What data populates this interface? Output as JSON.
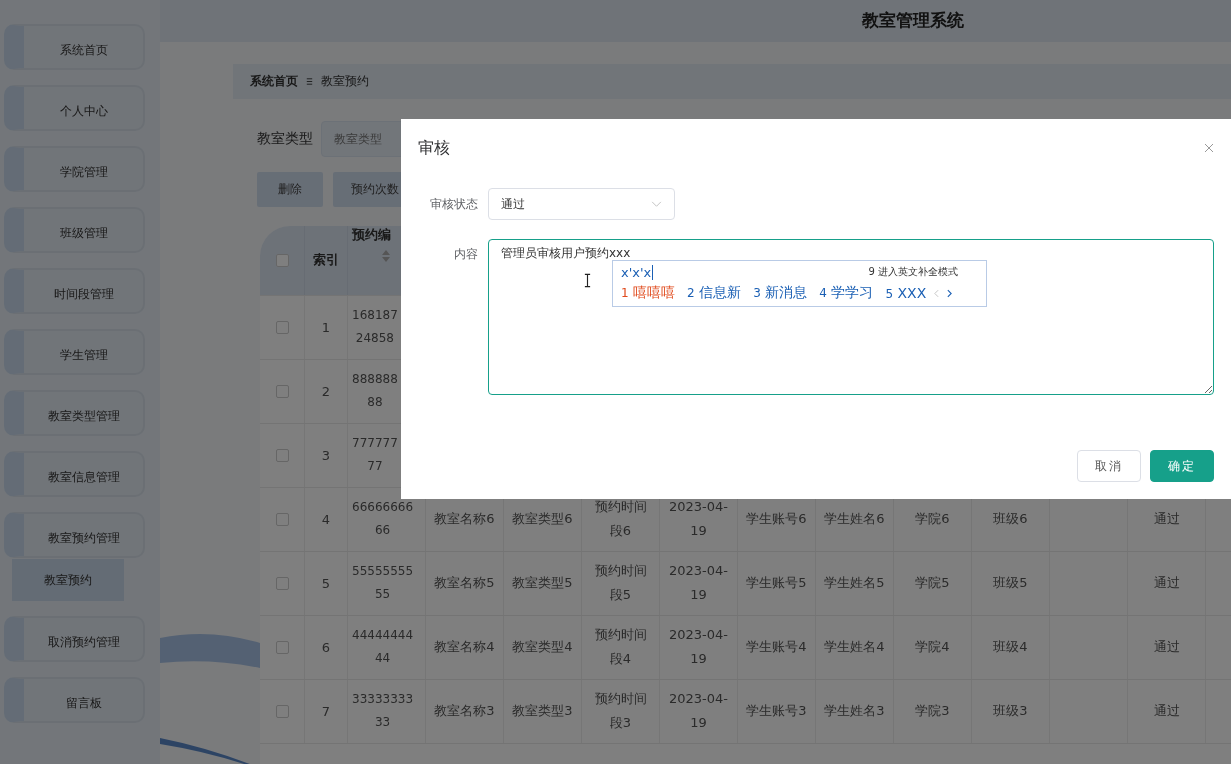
{
  "sidebar": {
    "items": [
      {
        "label": "系统首页"
      },
      {
        "label": "个人中心"
      },
      {
        "label": "学院管理"
      },
      {
        "label": "班级管理"
      },
      {
        "label": "时间段管理"
      },
      {
        "label": "学生管理"
      },
      {
        "label": "教室类型管理"
      },
      {
        "label": "教室信息管理"
      },
      {
        "label": "教室预约管理",
        "children": [
          {
            "label": "教室预约"
          }
        ]
      },
      {
        "label": "取消预约管理"
      },
      {
        "label": "留言板"
      }
    ]
  },
  "header": {
    "title": "教室管理系统"
  },
  "breadcrumb": [
    {
      "label": "系统首页"
    },
    {
      "label": "教室预约"
    }
  ],
  "filters": {
    "label": "教室类型",
    "placeholder": "教室类型"
  },
  "toolbar": [
    "删除",
    "预约次数"
  ],
  "table": {
    "select_all": false,
    "columns": [
      "索引",
      "预约编"
    ],
    "rows": [
      {
        "checked": false,
        "index": "1",
        "number": "168187\n24858"
      },
      {
        "checked": false,
        "index": "2",
        "number": "888888\n88"
      },
      {
        "checked": false,
        "index": "3",
        "number": "777777\n77"
      },
      {
        "checked": false,
        "index": "4",
        "number": "66666666\n66",
        "room_name": "教室名称6",
        "room_type": "教室类型6",
        "time_slot": "预约时间段6",
        "date": "2023-04-19",
        "student_account": "学生账号6",
        "student_name": "学生姓名6",
        "college": "学院6",
        "class": "班级6",
        "status": "通过"
      },
      {
        "checked": false,
        "index": "5",
        "number": "55555555\n55",
        "room_name": "教室名称5",
        "room_type": "教室类型5",
        "time_slot": "预约时间段5",
        "date": "2023-04-19",
        "student_account": "学生账号5",
        "student_name": "学生姓名5",
        "college": "学院5",
        "class": "班级5",
        "status": "通过"
      },
      {
        "checked": false,
        "index": "6",
        "number": "44444444\n44",
        "room_name": "教室名称4",
        "room_type": "教室类型4",
        "time_slot": "预约时间段4",
        "date": "2023-04-19",
        "student_account": "学生账号4",
        "student_name": "学生姓名4",
        "college": "学院4",
        "class": "班级4",
        "status": "通过"
      },
      {
        "checked": false,
        "index": "7",
        "number": "33333333\n33",
        "room_name": "教室名称3",
        "room_type": "教室类型3",
        "time_slot": "预约时间段3",
        "date": "2023-04-19",
        "student_account": "学生账号3",
        "student_name": "学生姓名3",
        "college": "学院3",
        "class": "班级3",
        "status": "通过"
      }
    ]
  },
  "dialog": {
    "title": "审核",
    "status_label": "审核状态",
    "status_value": "通过",
    "content_label": "内容",
    "content_value": "管理员审核用户预约xxx",
    "ime": {
      "composition": "x'x'x",
      "hint": "9 进入英文补全模式",
      "candidates": [
        {
          "num": "1",
          "text": "嘻嘻嘻",
          "selected": true
        },
        {
          "num": "2",
          "text": "信息新",
          "selected": false
        },
        {
          "num": "3",
          "text": "新消息",
          "selected": false
        },
        {
          "num": "4",
          "text": "学学习",
          "selected": false
        },
        {
          "num": "5",
          "text": "XXX",
          "selected": false
        }
      ]
    },
    "buttons": [
      {
        "label": "取消",
        "kind": "secondary"
      },
      {
        "label": "确定",
        "kind": "primary"
      }
    ]
  }
}
